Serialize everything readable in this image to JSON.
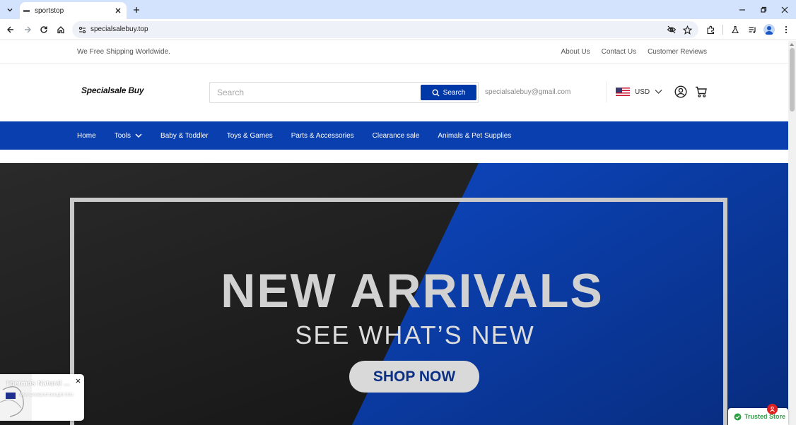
{
  "browser": {
    "tab_title": "sportstop",
    "url": "specialsalebuy.top"
  },
  "topbar": {
    "shipping_text": "We Free Shipping Worldwide.",
    "links": [
      "About Us",
      "Contact Us",
      "Customer Reviews"
    ]
  },
  "header": {
    "logo_text": "Specialsale Buy",
    "search_placeholder": "Search",
    "search_button": "Search",
    "email": "specialsalebuy@gmail.com",
    "currency": "USD"
  },
  "nav": {
    "items": [
      "Home",
      "Tools",
      "Baby & Toddler",
      "Toys & Games",
      "Parts & Accessories",
      "Clearance sale",
      "Animals & Pet Supplies"
    ]
  },
  "hero": {
    "title": "NEW ARRIVALS",
    "subtitle": "SEE WHAT’S NEW",
    "button": "SHOP NOW"
  },
  "sale_popup": {
    "title": "Thermos Natural ...",
    "from_text": "New Zealand bought this"
  },
  "trusted_store": {
    "label": "Trusted Store"
  },
  "colors": {
    "brand_blue": "#0a3fb0",
    "search_button": "#0038a8",
    "hero_dark": "#1b1b1b",
    "hero_blue": "#0b3aa3",
    "trusted_green": "#2e9e44"
  },
  "icons": [
    "tab-list-icon",
    "close-icon",
    "plus-icon",
    "minimize-icon",
    "restore-icon",
    "back-icon",
    "forward-icon",
    "reload-icon",
    "home-icon",
    "site-settings-icon",
    "eye-off-icon",
    "star-icon",
    "extensions-icon",
    "labs-icon",
    "media-icon",
    "profile-icon",
    "menu-dots-icon",
    "search-icon",
    "chevron-down-icon",
    "account-icon",
    "cart-icon",
    "shield-check-icon"
  ]
}
